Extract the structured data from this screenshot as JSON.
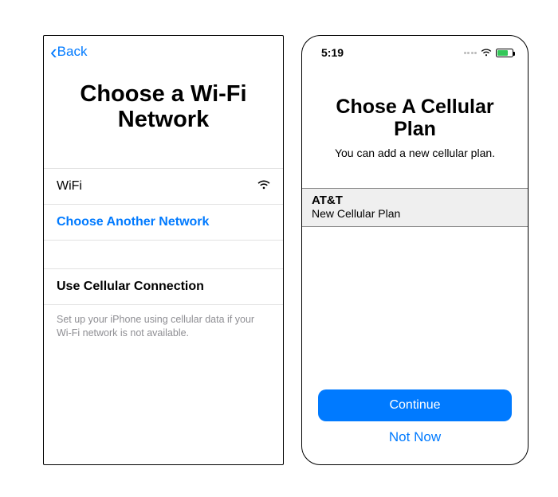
{
  "left": {
    "back_label": "Back",
    "title": "Choose a Wi-Fi Network",
    "wifi_name": "WiFi",
    "choose_another": "Choose Another Network",
    "use_cellular": "Use Cellular Connection",
    "footnote": "Set up your iPhone using cellular data if your Wi-Fi network is not available."
  },
  "right": {
    "time": "5:19",
    "title": "Chose A Cellular Plan",
    "subtitle": "You can add a new cellular plan.",
    "plan": {
      "carrier": "AT&T",
      "label": "New Cellular Plan"
    },
    "continue": "Continue",
    "not_now": "Not Now"
  }
}
